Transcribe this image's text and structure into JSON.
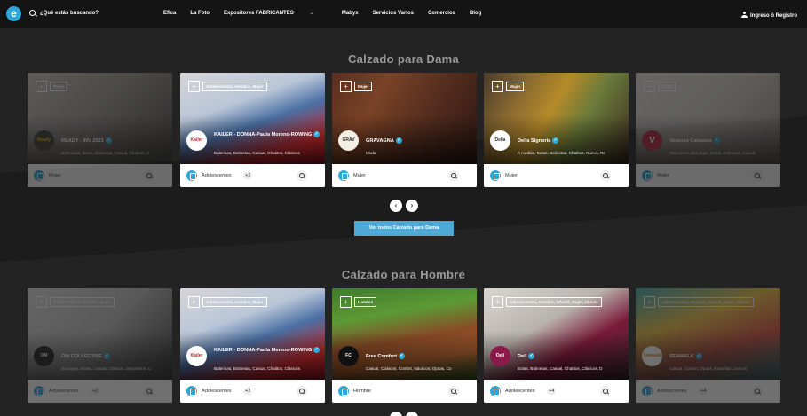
{
  "nav": {
    "search_placeholder": "¿Qué estás buscando?",
    "links": [
      "Efica",
      "La Foto",
      "Expositores FABRICANTES",
      "Mabyx",
      "Servicios Varios",
      "Comercios",
      "Blog"
    ],
    "login": "Ingreso ó Registro"
  },
  "dama": {
    "title": "Calzado para Dama",
    "see_all": "Ver todos Calzado para Dama",
    "cards": [
      {
        "tags": "Mujer",
        "logo": "Ready",
        "name": "READY - INV 2021",
        "cats": "Baloncitas, Botas, Botinetas, Casual, Chatitos, C",
        "foot": "Mujer",
        "count": ""
      },
      {
        "tags": "Adolescentes, Hombre, Mujer",
        "logo": "Kailer",
        "name": "KAILER - DONNA-Paula Moreno-ROWING",
        "cats": "Balerinas, Botinetas, Casual, Chatitos, Clásicos",
        "foot": "Adolescentes",
        "count": "+2"
      },
      {
        "tags": "Mujer",
        "logo": "GRAV",
        "name": "GRAVAGNA",
        "cats": "Moda",
        "foot": "Mujer",
        "count": ""
      },
      {
        "tags": "Mujer",
        "logo": "Della",
        "name": "Della Signoria",
        "cats": "A medida, Botas, Botinetas, Chatitos, Nuevo, Re",
        "foot": "Mujer",
        "count": ""
      },
      {
        "tags": "Mujer",
        "logo": "V",
        "name": "Venezza Calzados",
        "cats": "Alta Gama, Borcegos, Botas, Botinetas, Casual",
        "foot": "Mujer",
        "count": ""
      }
    ]
  },
  "hombre": {
    "title": "Calzado para Hombre",
    "cards": [
      {
        "tags": "Adolescentes, Hombre, Mujer",
        "logo": "OM",
        "name": "OM COLLECTIVE",
        "cats": "Borcegos, Botas, Casual, Clásicos, Deportivos, U",
        "foot": "Adolescentes",
        "count": "+2"
      },
      {
        "tags": "Adolescentes, Hombre, Mujer",
        "logo": "Kailer",
        "name": "KAILER - DONNA-Paula Moreno-ROWING",
        "cats": "Balerinas, Botinetas, Casual, Chatitos, Clásicos",
        "foot": "Adolescentes",
        "count": "+2"
      },
      {
        "tags": "Hombre",
        "logo": "FC",
        "name": "Free Comfort",
        "cats": "Casual, Clásicos, Confort, Náuticos, Ojotas, Co",
        "foot": "Hombre",
        "count": ""
      },
      {
        "tags": "Adolescentes, Hombre, Infantil, Mujer, Unisex",
        "logo": "Deli",
        "name": "Deli",
        "cats": "Botas, Botinetas, Casual, Chatitos, Clásicos, D",
        "foot": "Adolescentes",
        "count": "+4"
      },
      {
        "tags": "Adolescentes, Hombre, Infantil, Mujer, Unisex",
        "logo": "Seawalk",
        "name": "SEAWALK",
        "cats": "Casual, Confort, Ojotas, Pantuflas, Zuecos",
        "foot": "Adolescentes",
        "count": "+4"
      }
    ]
  },
  "colors": {
    "accent": "#2aa8d8",
    "background": "#232323",
    "button": "#4ea9d6"
  }
}
